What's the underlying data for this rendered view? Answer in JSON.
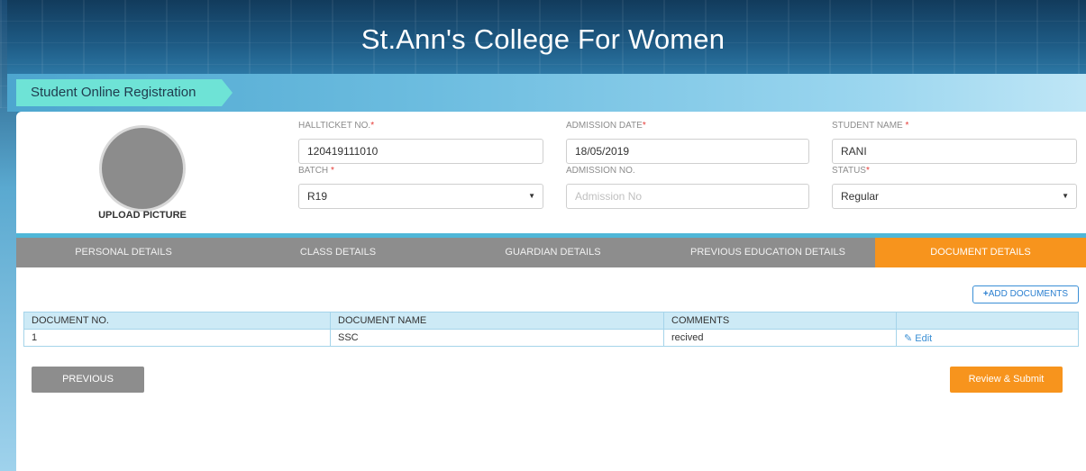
{
  "header": {
    "title": "St.Ann's College For Women"
  },
  "breadcrumb": {
    "label": "Student Online Registration"
  },
  "profile": {
    "upload_label": "UPLOAD PICTURE"
  },
  "fields": {
    "hallticket": {
      "label": "HALLTICKET NO.",
      "value": "120419111010"
    },
    "admission_date": {
      "label": "ADMISSION DATE",
      "value": "18/05/2019"
    },
    "student_name": {
      "label": "STUDENT NAME",
      "value": "RANI"
    },
    "batch": {
      "label": "BATCH",
      "value": "R19"
    },
    "admission_no": {
      "label": "ADMISSION NO.",
      "placeholder": "Admission No"
    },
    "status": {
      "label": "STATUS",
      "value": "Regular"
    },
    "required_mark": "*"
  },
  "tabs": [
    {
      "label": "PERSONAL DETAILS",
      "active": false
    },
    {
      "label": "CLASS DETAILS",
      "active": false
    },
    {
      "label": "GUARDIAN DETAILS",
      "active": false
    },
    {
      "label": "PREVIOUS EDUCATION DETAILS",
      "active": false
    },
    {
      "label": "DOCUMENT DETAILS",
      "active": true
    }
  ],
  "documents": {
    "add_button": "ADD DOCUMENTS",
    "columns": [
      "DOCUMENT NO.",
      "DOCUMENT NAME",
      "COMMENTS",
      ""
    ],
    "rows": [
      {
        "no": "1",
        "name": "SSC",
        "comments": "recived",
        "action": "Edit"
      }
    ]
  },
  "actions": {
    "previous": "PREVIOUS",
    "submit": "Review & Submit"
  },
  "colors": {
    "accent": "#f7941d",
    "tab_bar": "#8d8d8d",
    "breadcrumb": "#6ee3d6",
    "link": "#3b8fd4"
  },
  "icons": {
    "add": "plus-icon",
    "edit": "edit-icon",
    "caret": "caret-down-icon"
  }
}
